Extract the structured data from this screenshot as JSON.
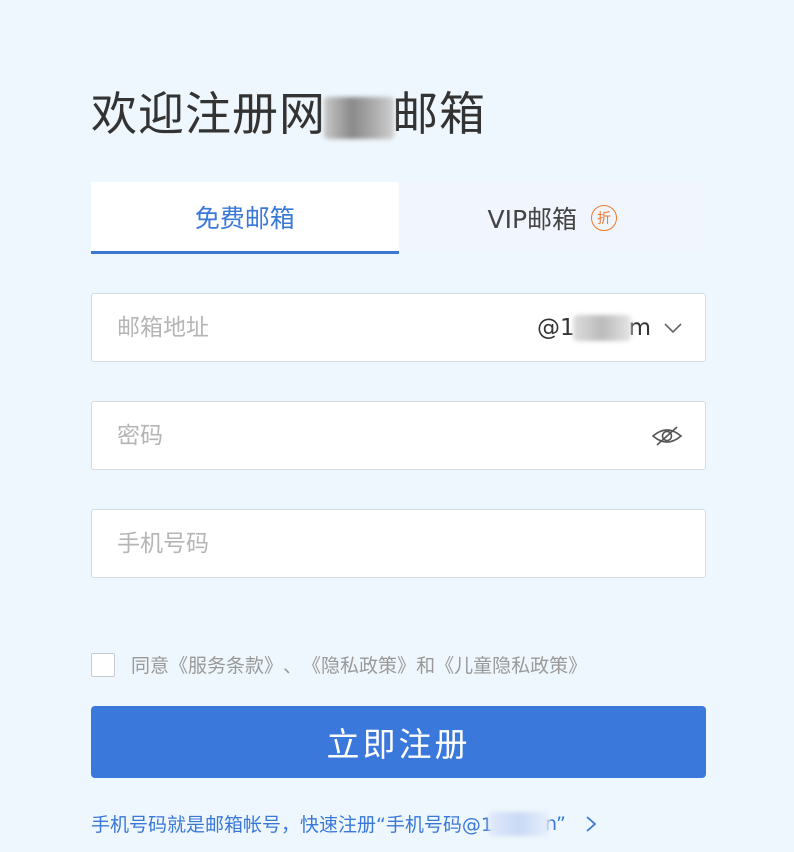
{
  "header": {
    "title_before": "欢迎注册网",
    "title_after": "邮箱"
  },
  "tabs": [
    {
      "label": "免费邮箱",
      "active": true
    },
    {
      "label": "VIP邮箱",
      "badge": "折",
      "active": false
    }
  ],
  "form": {
    "email_placeholder": "邮箱地址",
    "domain_prefix": "@1",
    "domain_suffix": "m",
    "password_placeholder": "密码",
    "phone_placeholder": "手机号码"
  },
  "agreement": {
    "prefix": "同意",
    "terms": "《服务条款》",
    "sep": "、",
    "privacy": "《隐私政策》",
    "and": "和",
    "child_privacy": "《儿童隐私政策》"
  },
  "submit_label": "立即注册",
  "footer": {
    "text_before": "手机号码就是邮箱帐号，快速注册“手机号码@1",
    "text_after": "n”"
  },
  "colors": {
    "accent": "#3a78db",
    "background": "#eef7fd",
    "discount": "#f07a2e"
  }
}
